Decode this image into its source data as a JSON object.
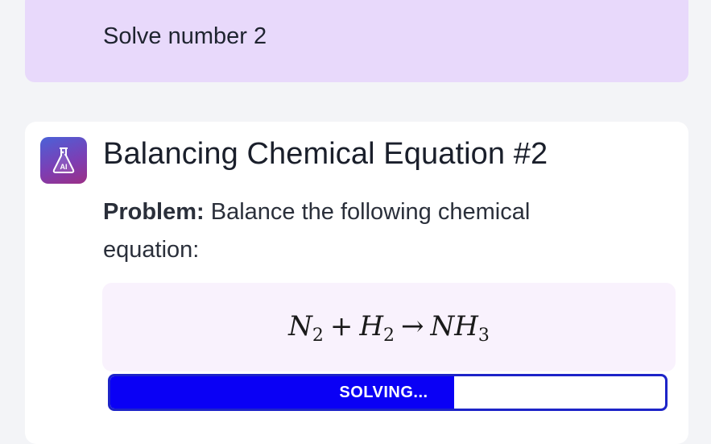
{
  "user_message": {
    "text": "Solve number 2"
  },
  "assistant": {
    "avatar_icon": "flask-ai-icon",
    "avatar_label": "AI",
    "title": "Balancing Chemical Equation #2",
    "problem_label": "Problem:",
    "problem_text": " Balance the following chemical equation:",
    "equation": {
      "lhs1": "N",
      "lhs1_sub": "2",
      "plus": "+",
      "lhs2": "H",
      "lhs2_sub": "2",
      "arrow": "→",
      "rhs": "NH",
      "rhs_sub": "3"
    },
    "progress": {
      "label": "SOLVING...",
      "fraction": 0.62,
      "color": "#0a00f5"
    }
  },
  "colors": {
    "user_bubble": "#e8d9fb",
    "card": "#ffffff",
    "equation_bg": "#f9f2fd",
    "progress_border": "#1d24c8"
  }
}
